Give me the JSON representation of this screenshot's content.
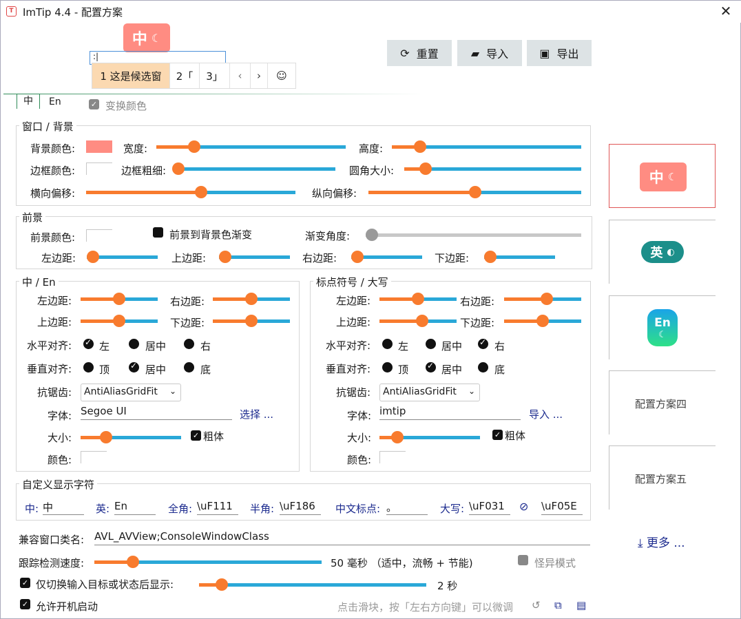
{
  "window": {
    "title": "ImTip 4.4 - 配置方案",
    "app_icon": "T",
    "close_icon": "✕"
  },
  "toolbar": {
    "reset": "重置",
    "import": "导入",
    "export": "导出"
  },
  "preview": {
    "badge_cn": "中",
    "candidates": [
      "1 这是候选窗",
      "2「",
      "3」"
    ],
    "input_text": ":|"
  },
  "tabs": {
    "cn": "中",
    "en": "En",
    "swap_label": "变换颜色"
  },
  "window_bg": {
    "legend": "窗口 / 背景",
    "bg_color": "背景颜色:",
    "width": "宽度:",
    "height": "高度:",
    "border_color": "边框颜色:",
    "border_thickness": "边框粗细:",
    "corner_radius": "圆角大小:",
    "h_offset": "横向偏移:",
    "v_offset": "纵向偏移:",
    "bg_hex": "#ff8c82"
  },
  "foreground": {
    "legend": "前景",
    "fg_color": "前景颜色:",
    "gradient": "前景到背景色渐变",
    "gradient_angle": "渐变角度:",
    "left": "左边距:",
    "top": "上边距:",
    "right": "右边距:",
    "bottom": "下边距:"
  },
  "cn_en": {
    "legend": "中 / En",
    "left": "左边距:",
    "right": "右边距:",
    "top": "上边距:",
    "bottom": "下边距:",
    "halign": "水平对齐:",
    "valign": "垂直对齐:",
    "h_left": "左",
    "h_center": "居中",
    "h_right": "右",
    "v_top": "顶",
    "v_center": "居中",
    "v_bottom": "底",
    "aa": "抗锯齿:",
    "aa_value": "AntiAliasGridFit",
    "font": "字体:",
    "font_value": "Segoe UI",
    "choose": "选择 ...",
    "size": "大小:",
    "bold": "粗体",
    "color": "颜色:"
  },
  "punct": {
    "legend": "标点符号 / 大写",
    "left": "左边距:",
    "right": "右边距:",
    "top": "上边距:",
    "bottom": "下边距:",
    "halign": "水平对齐:",
    "valign": "垂直对齐:",
    "h_left": "左",
    "h_center": "居中",
    "h_right": "右",
    "v_top": "顶",
    "v_center": "居中",
    "v_bottom": "底",
    "aa": "抗锯齿:",
    "aa_value": "AntiAliasGridFit",
    "font": "字体:",
    "font_value": "imtip",
    "import": "导入 ...",
    "size": "大小:",
    "bold": "粗体",
    "color": "颜色:"
  },
  "custom": {
    "legend": "自定义显示字符",
    "cn": "中:",
    "cn_v": "中",
    "en": "英:",
    "en_v": "En",
    "full": "全角:",
    "full_v": "\\uF111",
    "half": "半角:",
    "half_v": "\\uF186",
    "cnp": "中文标点:",
    "cnp_v": "。",
    "caps": "大写:",
    "caps_v": "\\uF031",
    "none_v": "\\uF05E"
  },
  "bottom": {
    "compat": "兼容窗口类名:",
    "compat_v": "AVL_AVView;ConsoleWindowClass",
    "speed": "跟踪检测速度:",
    "speed_v": "50 毫秒 （适中，流畅 + 节能)",
    "weird": "怪异模式",
    "only": "仅切换输入目标或状态后显示:",
    "only_v": "2 秒",
    "autostart": "允许开机启动",
    "hint": "点击滑块，按「左右方向键」可以微调"
  },
  "schemes": {
    "cn": "中",
    "en": "英",
    "en2": "En",
    "s4": "配置方案四",
    "s5": "配置方案五",
    "more": "更多 ..."
  },
  "sliders": {
    "width": 0.2,
    "height": 0.15,
    "border": 0.01,
    "radius": 0.12,
    "hoff": 0.55,
    "voff": 0.5,
    "angle": 0,
    "fl": 0,
    "ft": 0,
    "fr": 0,
    "fb": 0,
    "c_l": 0.5,
    "c_r": 0.5,
    "c_t": 0.5,
    "c_b": 0.5,
    "c_size": 0.25,
    "p_l": 0.5,
    "p_r": 0.55,
    "p_t": 0.55,
    "p_b": 0.5,
    "p_size": 0.18,
    "speed": 0.17,
    "only": 0.1
  },
  "colors": {
    "accent": "#f87b2e",
    "track": "#2aa8d8",
    "badge_cn": "#ff8c82",
    "badge_en": "#1c8f8a",
    "link": "#1b2a8e"
  }
}
